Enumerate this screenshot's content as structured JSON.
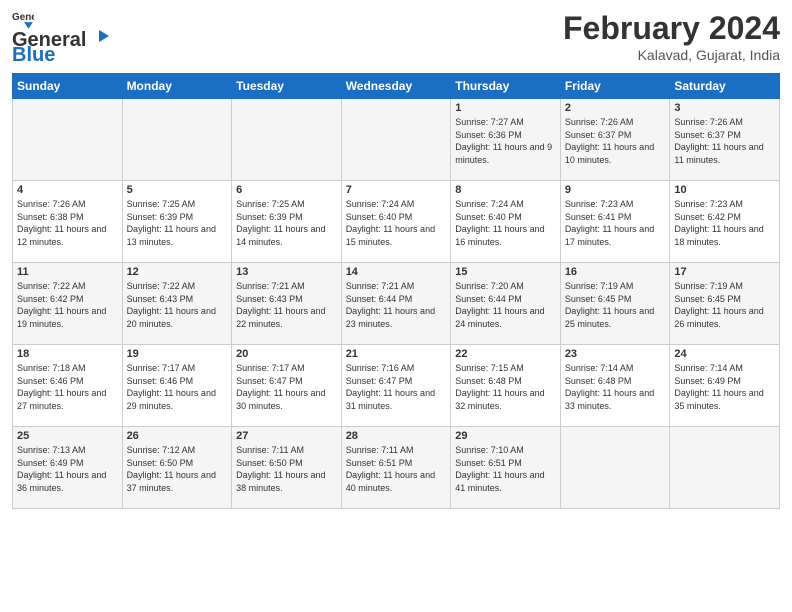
{
  "logo": {
    "general": "General",
    "blue": "Blue"
  },
  "title": "February 2024",
  "location": "Kalavad, Gujarat, India",
  "days_of_week": [
    "Sunday",
    "Monday",
    "Tuesday",
    "Wednesday",
    "Thursday",
    "Friday",
    "Saturday"
  ],
  "weeks": [
    [
      {
        "day": "",
        "info": ""
      },
      {
        "day": "",
        "info": ""
      },
      {
        "day": "",
        "info": ""
      },
      {
        "day": "",
        "info": ""
      },
      {
        "day": "1",
        "info": "Sunrise: 7:27 AM\nSunset: 6:36 PM\nDaylight: 11 hours and 9 minutes."
      },
      {
        "day": "2",
        "info": "Sunrise: 7:26 AM\nSunset: 6:37 PM\nDaylight: 11 hours and 10 minutes."
      },
      {
        "day": "3",
        "info": "Sunrise: 7:26 AM\nSunset: 6:37 PM\nDaylight: 11 hours and 11 minutes."
      }
    ],
    [
      {
        "day": "4",
        "info": "Sunrise: 7:26 AM\nSunset: 6:38 PM\nDaylight: 11 hours and 12 minutes."
      },
      {
        "day": "5",
        "info": "Sunrise: 7:25 AM\nSunset: 6:39 PM\nDaylight: 11 hours and 13 minutes."
      },
      {
        "day": "6",
        "info": "Sunrise: 7:25 AM\nSunset: 6:39 PM\nDaylight: 11 hours and 14 minutes."
      },
      {
        "day": "7",
        "info": "Sunrise: 7:24 AM\nSunset: 6:40 PM\nDaylight: 11 hours and 15 minutes."
      },
      {
        "day": "8",
        "info": "Sunrise: 7:24 AM\nSunset: 6:40 PM\nDaylight: 11 hours and 16 minutes."
      },
      {
        "day": "9",
        "info": "Sunrise: 7:23 AM\nSunset: 6:41 PM\nDaylight: 11 hours and 17 minutes."
      },
      {
        "day": "10",
        "info": "Sunrise: 7:23 AM\nSunset: 6:42 PM\nDaylight: 11 hours and 18 minutes."
      }
    ],
    [
      {
        "day": "11",
        "info": "Sunrise: 7:22 AM\nSunset: 6:42 PM\nDaylight: 11 hours and 19 minutes."
      },
      {
        "day": "12",
        "info": "Sunrise: 7:22 AM\nSunset: 6:43 PM\nDaylight: 11 hours and 20 minutes."
      },
      {
        "day": "13",
        "info": "Sunrise: 7:21 AM\nSunset: 6:43 PM\nDaylight: 11 hours and 22 minutes."
      },
      {
        "day": "14",
        "info": "Sunrise: 7:21 AM\nSunset: 6:44 PM\nDaylight: 11 hours and 23 minutes."
      },
      {
        "day": "15",
        "info": "Sunrise: 7:20 AM\nSunset: 6:44 PM\nDaylight: 11 hours and 24 minutes."
      },
      {
        "day": "16",
        "info": "Sunrise: 7:19 AM\nSunset: 6:45 PM\nDaylight: 11 hours and 25 minutes."
      },
      {
        "day": "17",
        "info": "Sunrise: 7:19 AM\nSunset: 6:45 PM\nDaylight: 11 hours and 26 minutes."
      }
    ],
    [
      {
        "day": "18",
        "info": "Sunrise: 7:18 AM\nSunset: 6:46 PM\nDaylight: 11 hours and 27 minutes."
      },
      {
        "day": "19",
        "info": "Sunrise: 7:17 AM\nSunset: 6:46 PM\nDaylight: 11 hours and 29 minutes."
      },
      {
        "day": "20",
        "info": "Sunrise: 7:17 AM\nSunset: 6:47 PM\nDaylight: 11 hours and 30 minutes."
      },
      {
        "day": "21",
        "info": "Sunrise: 7:16 AM\nSunset: 6:47 PM\nDaylight: 11 hours and 31 minutes."
      },
      {
        "day": "22",
        "info": "Sunrise: 7:15 AM\nSunset: 6:48 PM\nDaylight: 11 hours and 32 minutes."
      },
      {
        "day": "23",
        "info": "Sunrise: 7:14 AM\nSunset: 6:48 PM\nDaylight: 11 hours and 33 minutes."
      },
      {
        "day": "24",
        "info": "Sunrise: 7:14 AM\nSunset: 6:49 PM\nDaylight: 11 hours and 35 minutes."
      }
    ],
    [
      {
        "day": "25",
        "info": "Sunrise: 7:13 AM\nSunset: 6:49 PM\nDaylight: 11 hours and 36 minutes."
      },
      {
        "day": "26",
        "info": "Sunrise: 7:12 AM\nSunset: 6:50 PM\nDaylight: 11 hours and 37 minutes."
      },
      {
        "day": "27",
        "info": "Sunrise: 7:11 AM\nSunset: 6:50 PM\nDaylight: 11 hours and 38 minutes."
      },
      {
        "day": "28",
        "info": "Sunrise: 7:11 AM\nSunset: 6:51 PM\nDaylight: 11 hours and 40 minutes."
      },
      {
        "day": "29",
        "info": "Sunrise: 7:10 AM\nSunset: 6:51 PM\nDaylight: 11 hours and 41 minutes."
      },
      {
        "day": "",
        "info": ""
      },
      {
        "day": "",
        "info": ""
      }
    ]
  ]
}
